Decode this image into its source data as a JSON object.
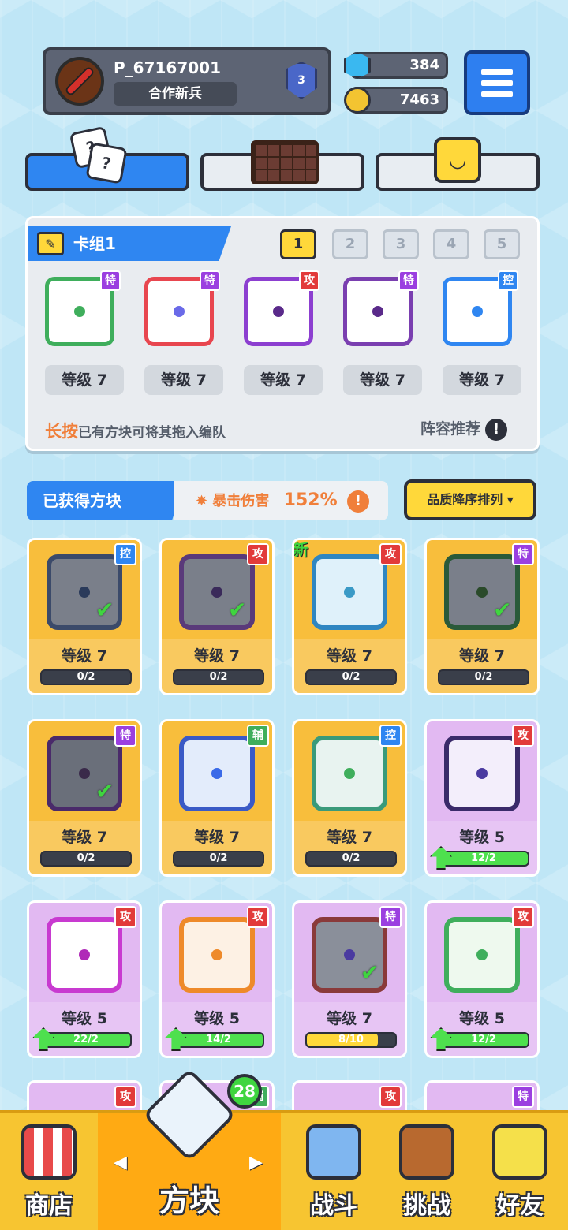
{
  "profile": {
    "name": "P_67167001",
    "title": "合作新兵",
    "rank": "3"
  },
  "currency": {
    "gems": "384",
    "coins": "7463"
  },
  "deck": {
    "title": "卡组1",
    "slots": [
      "1",
      "2",
      "3",
      "4",
      "5"
    ],
    "cards": [
      {
        "tag": "特",
        "level": "等级 7",
        "tag_color": "#9b3fe0",
        "frame": "#3fae5c",
        "dot": "#3fae5c"
      },
      {
        "tag": "特",
        "level": "等级 7",
        "tag_color": "#9b3fe0",
        "frame": "#e8464f",
        "dot": "#6a6ae8"
      },
      {
        "tag": "攻",
        "level": "等级 7",
        "tag_color": "#e23a3a",
        "frame": "#8c3fd0",
        "dot": "#5a2a8a"
      },
      {
        "tag": "特",
        "level": "等级 7",
        "tag_color": "#9b3fe0",
        "frame": "#7a3fb0",
        "dot": "#5a2a8a"
      },
      {
        "tag": "控",
        "level": "等级 7",
        "tag_color": "#2f86f1",
        "frame": "#2f86f1",
        "dot": "#2f86f1"
      }
    ],
    "hint_strong": "长按",
    "hint_rest": "已有方块可将其拖入编队",
    "recommend": "阵容推荐",
    "excl": "!"
  },
  "owned": {
    "title": "已获得方块",
    "crit_label": "暴击伤害",
    "crit_value": "152%",
    "excl": "!",
    "sort": "品质降序排列 ▾"
  },
  "grid": [
    {
      "tag": "控",
      "tag_color": "#2f86f1",
      "level": "等级 7",
      "progress": "0/2",
      "fill": 0,
      "bg": "gold",
      "frame": "#3b4a6a",
      "inner": "#7a7f8a",
      "dot": "#2a3a5a",
      "check": "✔"
    },
    {
      "tag": "攻",
      "tag_color": "#e23a3a",
      "level": "等级 7",
      "progress": "0/2",
      "fill": 0,
      "bg": "gold",
      "frame": "#5a3a7a",
      "inner": "#7a7f8a",
      "dot": "#3a2a5a",
      "check": "✔"
    },
    {
      "tag": "攻",
      "tag_color": "#e23a3a",
      "level": "等级 7",
      "progress": "0/2",
      "fill": 0,
      "bg": "gold",
      "frame": "#2f86c1",
      "inner": "#dff1fa",
      "dot": "#3a9ac6",
      "new": "新"
    },
    {
      "tag": "特",
      "tag_color": "#9b3fe0",
      "level": "等级 7",
      "progress": "0/2",
      "fill": 0,
      "bg": "gold",
      "frame": "#2a5a3a",
      "inner": "#7a7f8a",
      "dot": "#2a4a2a",
      "check": "✔"
    },
    {
      "tag": "特",
      "tag_color": "#9b3fe0",
      "level": "等级 7",
      "progress": "0/2",
      "fill": 0,
      "bg": "gold",
      "frame": "#4a2a6a",
      "inner": "#6a6f7a",
      "dot": "#3a2a4a",
      "check": "✔"
    },
    {
      "tag": "辅",
      "tag_color": "#3fae5c",
      "level": "等级 7",
      "progress": "0/2",
      "fill": 0,
      "bg": "gold",
      "frame": "#3a5ac6",
      "inner": "#e3ecfb",
      "dot": "#3a6ae8"
    },
    {
      "tag": "控",
      "tag_color": "#2f86f1",
      "level": "等级 7",
      "progress": "0/2",
      "fill": 0,
      "bg": "gold",
      "frame": "#3a9a7a",
      "inner": "#e8f3f0",
      "dot": "#3fae5c"
    },
    {
      "tag": "攻",
      "tag_color": "#e23a3a",
      "level": "等级 5",
      "progress": "12/2",
      "fill": 1,
      "bg": "purple",
      "frame": "#3a2a6a",
      "inner": "#f3eefb",
      "dot": "#4a3aa0",
      "up": true
    },
    {
      "tag": "攻",
      "tag_color": "#e23a3a",
      "level": "等级 5",
      "progress": "22/2",
      "fill": 1,
      "bg": "purple",
      "frame": "#c83ad0",
      "inner": "#fff",
      "dot": "#b02ab8",
      "up": true
    },
    {
      "tag": "攻",
      "tag_color": "#e23a3a",
      "level": "等级 5",
      "progress": "14/2",
      "fill": 1,
      "bg": "purple",
      "frame": "#ee8a2a",
      "inner": "#fdf1e4",
      "dot": "#ee8a2a",
      "up": true
    },
    {
      "tag": "特",
      "tag_color": "#9b3fe0",
      "level": "等级 7",
      "progress": "8/10",
      "fill": 0.8,
      "bg": "purple",
      "frame": "#8a3a3a",
      "inner": "#8a8f9a",
      "dot": "#4a3aa0",
      "check": "✔",
      "yellow": true
    },
    {
      "tag": "攻",
      "tag_color": "#e23a3a",
      "level": "等级 5",
      "progress": "12/2",
      "fill": 1,
      "bg": "purple",
      "frame": "#3fae5c",
      "inner": "#eef9ee",
      "dot": "#3fae5c",
      "up": true
    }
  ],
  "partial_tags": [
    {
      "tag": "攻",
      "tag_color": "#e23a3a"
    },
    {
      "tag": "辅",
      "tag_color": "#3fae5c"
    },
    {
      "tag": "攻",
      "tag_color": "#e23a3a"
    },
    {
      "tag": "特",
      "tag_color": "#9b3fe0"
    }
  ],
  "nav": {
    "shop": "商店",
    "blocks": "方块",
    "battle": "战斗",
    "challenge": "挑战",
    "friends": "好友",
    "badge": "28",
    "left": "◀",
    "right": "▶"
  }
}
